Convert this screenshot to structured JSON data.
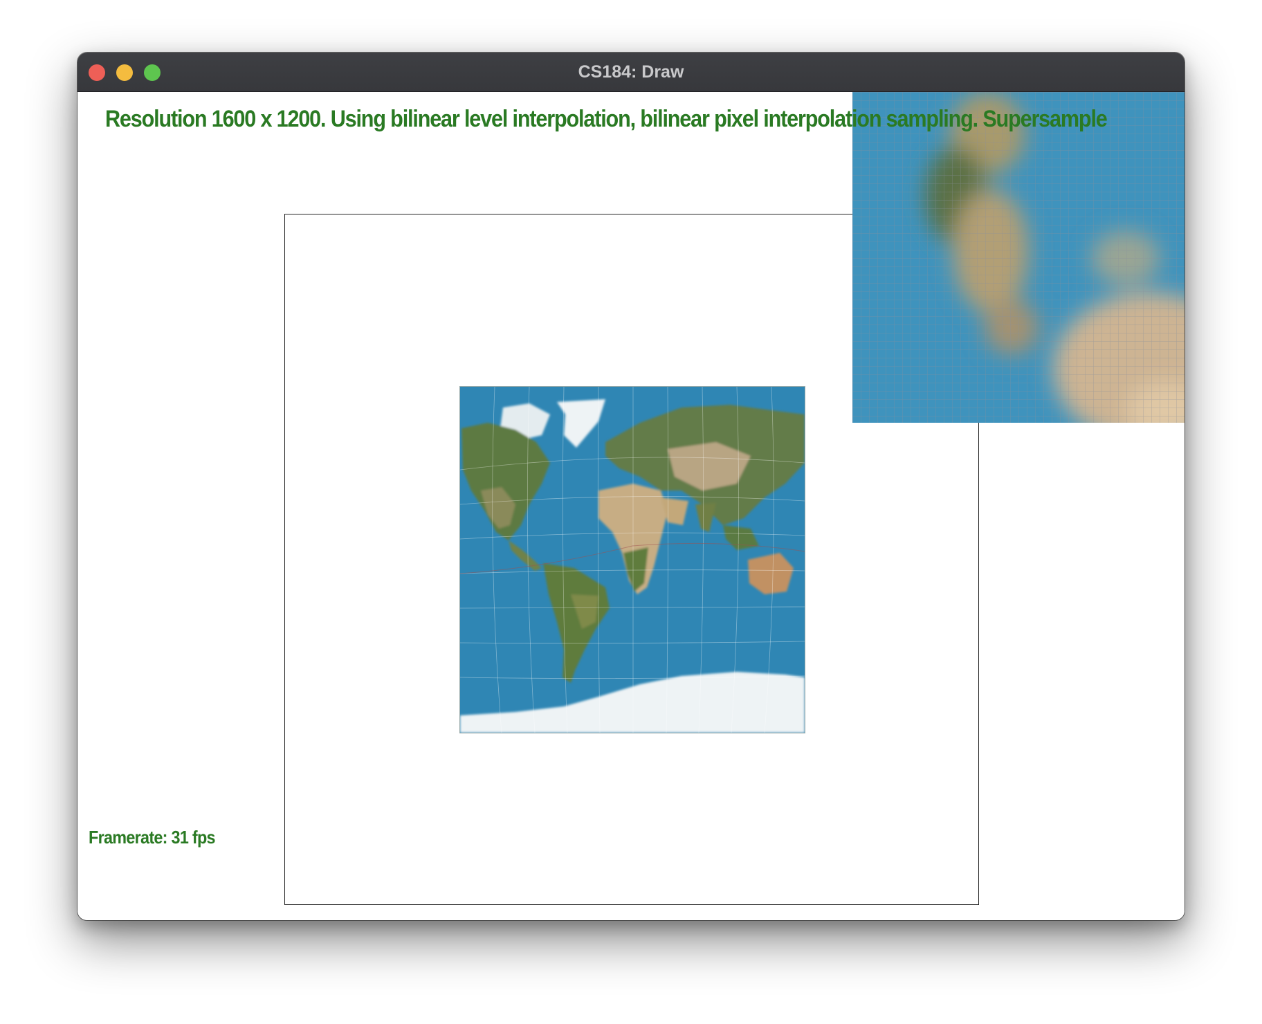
{
  "window": {
    "title": "CS184: Draw",
    "controls": [
      "close-button",
      "minimize-button",
      "maximize-button"
    ]
  },
  "overlay": {
    "status_text": "Resolution 1600 x 1200. Using bilinear level interpolation, bilinear pixel interpolation sampling. Supersample",
    "framerate_text": "Framerate: 31 fps",
    "text_color": "#2a7a23"
  },
  "scene": {
    "texture": "world map (satellite imagery) on a square quad",
    "zoom_inset": "magnified pixel grid view of the region under the cursor"
  },
  "colors": {
    "ocean": "#2f86b4",
    "land_green": "#5d7a43",
    "land_tan": "#c7ad84",
    "ice": "#eef3f5",
    "titlebar": "#3a3b3f",
    "close": "#ee5f57",
    "minimize": "#f4bc3f",
    "maximize": "#5ec54f"
  }
}
